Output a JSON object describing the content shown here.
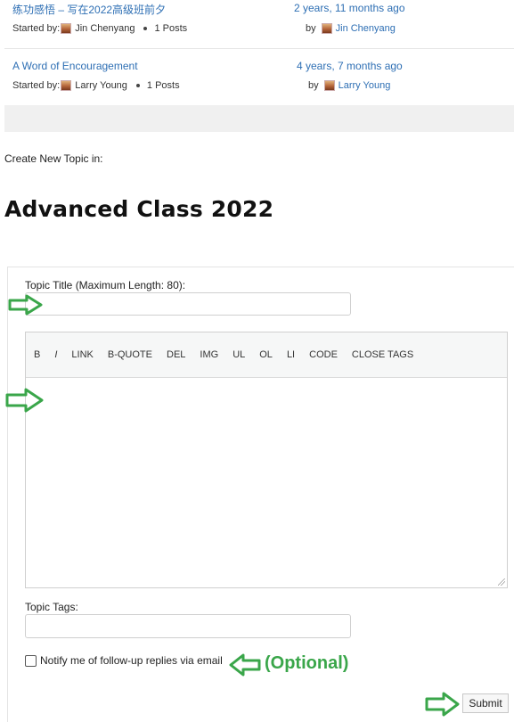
{
  "topics": [
    {
      "title": "练功感悟 – 写在2022高级班前夕",
      "started_by_label": "Started by:",
      "author": "Jin Chenyang",
      "posts": "1 Posts",
      "freshness": "2 years, 11 months ago",
      "by_label": "by",
      "last_author": "Jin Chenyang"
    },
    {
      "title": "A Word of Encouragement",
      "started_by_label": "Started by:",
      "author": "Larry Young",
      "posts": "1 Posts",
      "freshness": "4 years, 7 months ago",
      "by_label": "by",
      "last_author": "Larry Young"
    }
  ],
  "create": {
    "label": "Create New Topic in:",
    "forum_title": "Advanced Class 2022"
  },
  "form": {
    "topic_title_label": "Topic Title (Maximum Length: 80):",
    "topic_title_value": "",
    "toolbar": [
      "B",
      "I",
      "LINK",
      "B-QUOTE",
      "DEL",
      "IMG",
      "UL",
      "OL",
      "LI",
      "CODE",
      "CLOSE TAGS"
    ],
    "content_value": "",
    "tags_label": "Topic Tags:",
    "tags_value": "",
    "notify_label": "Notify me of follow-up replies via email",
    "notify_checked": false,
    "optional_note": "(Optional)",
    "submit_label": "Submit"
  },
  "colors": {
    "link": "#2e6fb4",
    "annotation_arrow": "#3aa64a"
  }
}
